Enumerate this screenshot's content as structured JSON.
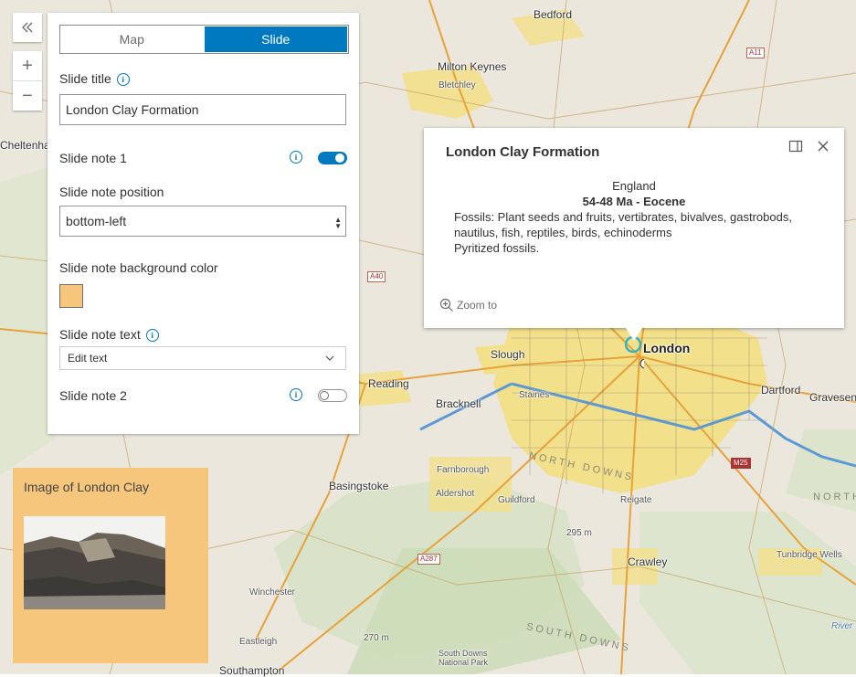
{
  "map": {
    "places": {
      "bedford": "Bedford",
      "milton_keynes": "Milton Keynes",
      "bletchley": "Bletchley",
      "cheltenham": "Cheltenha",
      "london": "London",
      "slough": "Slough",
      "reading": "Reading",
      "bracknell": "Bracknell",
      "staines": "Staines",
      "dartford": "Dartford",
      "gravesend": "Gravesen",
      "basingstoke": "Basingstoke",
      "farnborough": "Farnborough",
      "aldershot": "Aldershot",
      "guildford": "Guildford",
      "reigate": "Reigate",
      "crawley": "Crawley",
      "tunbridge_wells": "Tunbridge Wells",
      "winchester": "Winchester",
      "eastleigh": "Eastleigh",
      "southampton": "Southampton",
      "south_downs_np": "South Downs National Park",
      "north_downs": "NORTH DOWNS",
      "south_downs": "SOUTH DOWNS",
      "north": "NORTH",
      "river": "River",
      "elev_295": "295 m",
      "elev_270": "270 m"
    },
    "roads": {
      "a11": "A11",
      "a40": "A40",
      "m25": "M25",
      "a287": "A287"
    }
  },
  "zoom_controls": {
    "collapse_icon": "double-chevron-left-icon",
    "zoom_in": "+",
    "zoom_out": "−"
  },
  "panel": {
    "segment": {
      "map_label": "Map",
      "slide_label": "Slide",
      "selected": "Slide"
    },
    "slide_title_label": "Slide title",
    "slide_title_value": "London Clay Formation",
    "slide_note_1_label": "Slide note 1",
    "slide_note_1_enabled": true,
    "note_position_label": "Slide note position",
    "note_position_value": "bottom-left",
    "note_bg_label": "Slide note background color",
    "note_bg_color": "#f5c67b",
    "note_text_label": "Slide note text",
    "note_text_dropdown": "Edit text",
    "slide_note_2_label": "Slide note 2",
    "slide_note_2_enabled": false,
    "info_glyph": "i"
  },
  "popup": {
    "title": "London Clay Formation",
    "line1": "England",
    "line2": "54-48 Ma - Eocene",
    "line3": "Fossils: Plant seeds and fruits, vertibrates, bivalves, gastrobods, nautilus, fish, reptiles, birds, echinoderms",
    "line4": "Pyritized fossils.",
    "zoom_to": "Zoom to"
  },
  "slide_note": {
    "text": "Image of London Clay"
  },
  "colors": {
    "accent": "#0079c1",
    "note_bg": "#f5c67b",
    "urban": "#f3e08a"
  }
}
